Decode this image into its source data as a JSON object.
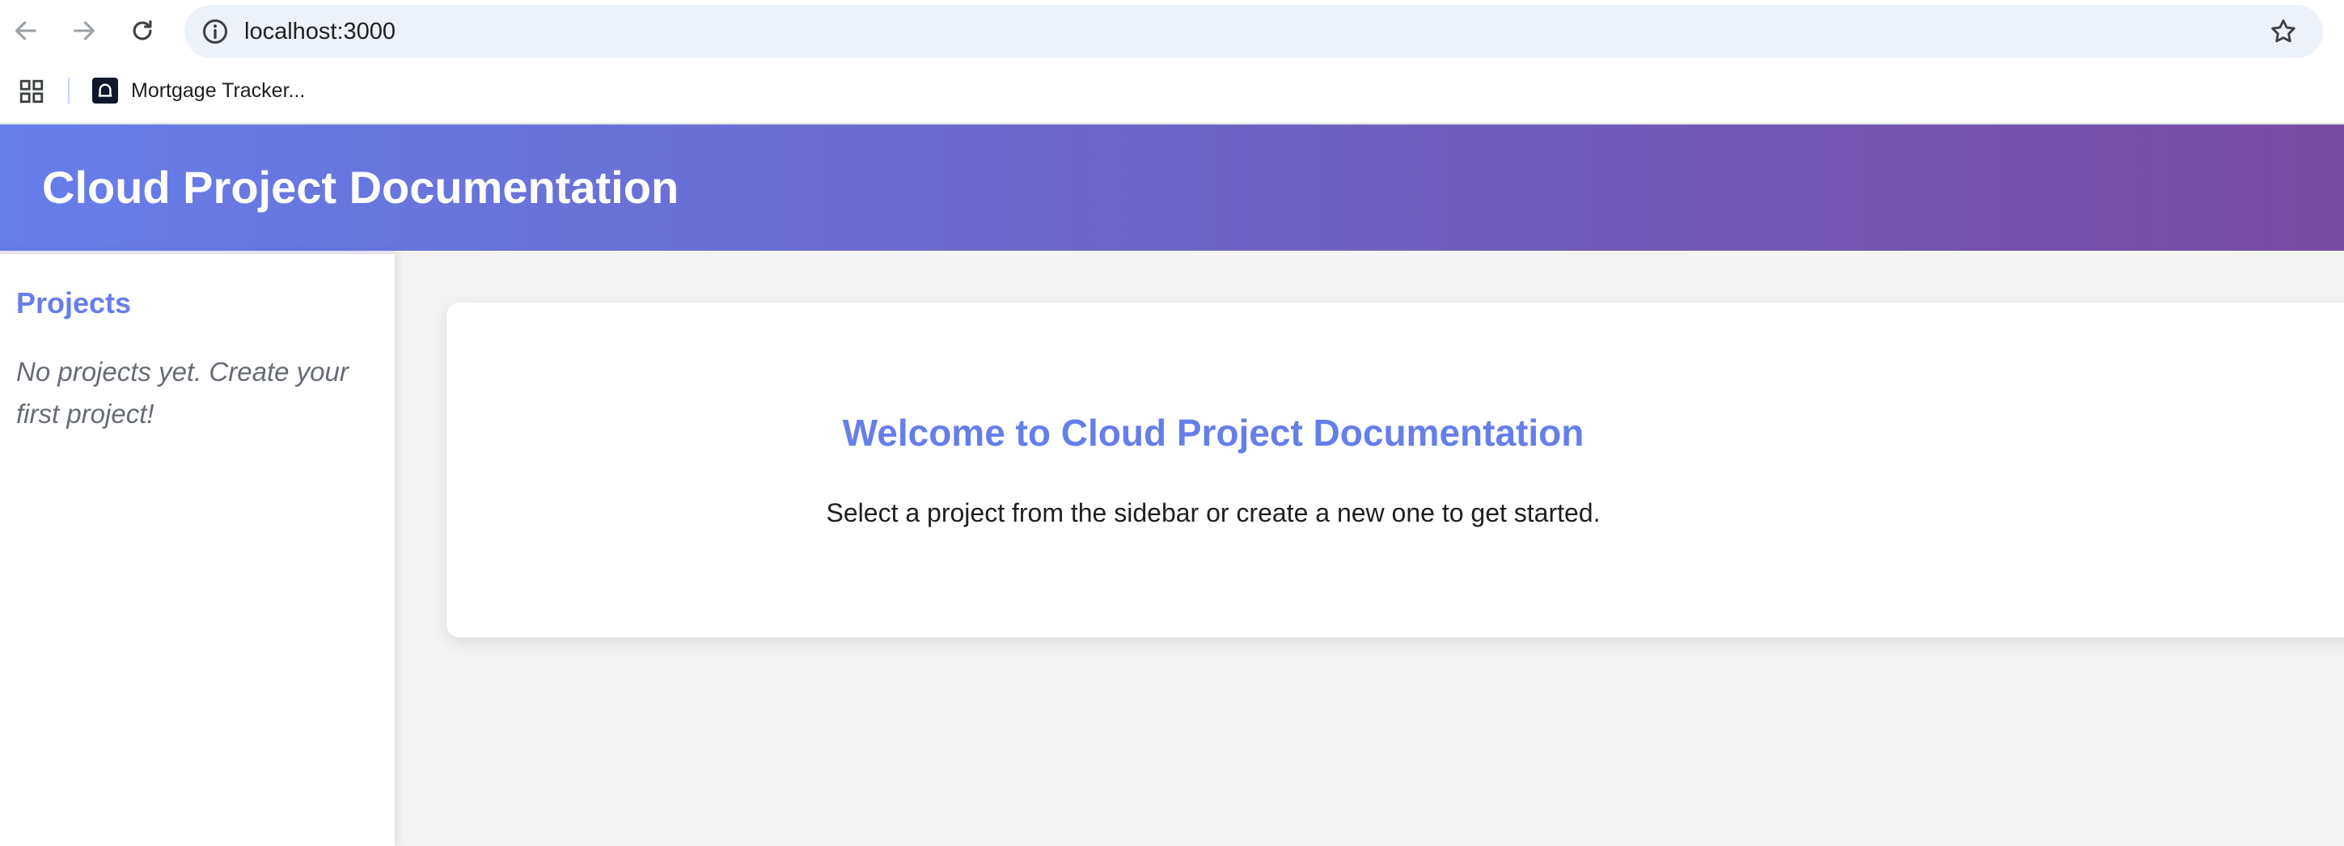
{
  "browser": {
    "url": "localhost:3000",
    "icons": {
      "back": "arrow-left",
      "forward": "arrow-right",
      "reload": "reload",
      "site_info": "info-circle",
      "bookmark_star": "star-outline",
      "apps": "grid"
    },
    "bookmarks": [
      {
        "label": "Mortgage Tracker..."
      }
    ]
  },
  "header": {
    "title": "Cloud Project Documentation"
  },
  "sidebar": {
    "heading": "Projects",
    "empty_message": "No projects yet. Create your first project!"
  },
  "main": {
    "welcome_title": "Welcome to Cloud Project Documentation",
    "welcome_subtitle": "Select a project from the sidebar or create a new one to get started."
  },
  "colors": {
    "accent": "#667eea",
    "gradient_start": "#667eea",
    "gradient_end": "#764ba2",
    "main_background": "#f4f4f4"
  }
}
